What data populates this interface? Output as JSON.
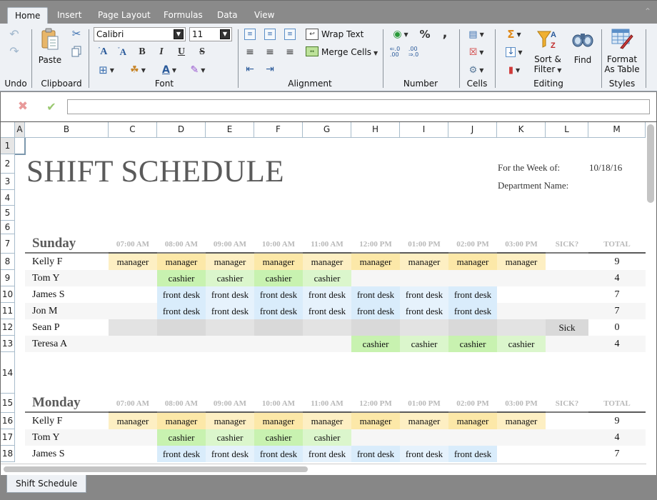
{
  "ribbon_tabs": [
    "Home",
    "Insert",
    "Page Layout",
    "Formulas",
    "Data",
    "View"
  ],
  "active_tab": "Home",
  "ribbon": {
    "groups": {
      "undo": "Undo",
      "clipboard": "Clipboard",
      "font": "Font",
      "alignment": "Alignment",
      "number": "Number",
      "cells": "Cells",
      "editing": "Editing",
      "styles": "Styles"
    },
    "paste_label": "Paste",
    "font_name": "Calibri",
    "font_size": "11",
    "wrap_text_label": "Wrap Text",
    "merge_cells_label": "Merge Cells",
    "sort_filter_line1": "Sort &",
    "sort_filter_line2": "Filter",
    "find_label": "Find",
    "format_table_line1": "Format",
    "format_table_line2": "As Table",
    "font_buttons": {
      "bold": "B",
      "italic": "I",
      "underline": "U",
      "strike": "S",
      "grow": "A",
      "shrink": "A"
    },
    "number_buttons": {
      "percent": "%",
      "comma": ","
    }
  },
  "formula_bar": {
    "value": ""
  },
  "columns": [
    "A",
    "B",
    "C",
    "D",
    "E",
    "F",
    "G",
    "H",
    "I",
    "J",
    "K",
    "L",
    "M"
  ],
  "rows": [
    "1",
    "2",
    "3",
    "4",
    "5",
    "6",
    "7",
    "8",
    "9",
    "10",
    "11",
    "12",
    "13",
    "14",
    "15",
    "16",
    "17",
    "18"
  ],
  "sheet": {
    "title": "SHIFT SCHEDULE",
    "week_label": "For the Week of:",
    "week_value": "10/18/16",
    "department_label": "Department Name:",
    "hours": [
      "07:00 AM",
      "08:00 AM",
      "09:00 AM",
      "10:00 AM",
      "11:00 AM",
      "12:00 PM",
      "01:00 PM",
      "02:00 PM",
      "03:00 PM"
    ],
    "sick_header": "SICK?",
    "total_header": "TOTAL",
    "days": [
      {
        "name": "Sunday",
        "employees": [
          {
            "name": "Kelly F",
            "shifts": [
              "manager",
              "manager",
              "manager",
              "manager",
              "manager",
              "manager",
              "manager",
              "manager",
              "manager"
            ],
            "sick": "",
            "total": "9"
          },
          {
            "name": "Tom Y",
            "shifts": [
              "",
              "cashier",
              "cashier",
              "cashier",
              "cashier",
              "",
              "",
              "",
              ""
            ],
            "sick": "",
            "total": "4"
          },
          {
            "name": "James S",
            "shifts": [
              "",
              "front desk",
              "front desk",
              "front desk",
              "front desk",
              "front desk",
              "front desk",
              "front desk",
              ""
            ],
            "sick": "",
            "total": "7"
          },
          {
            "name": "Jon M",
            "shifts": [
              "",
              "front desk",
              "front desk",
              "front desk",
              "front desk",
              "front desk",
              "front desk",
              "front desk",
              ""
            ],
            "sick": "",
            "total": "7"
          },
          {
            "name": "Sean P",
            "shifts": [
              "",
              "",
              "",
              "",
              "",
              "",
              "",
              "",
              ""
            ],
            "sick": "Sick",
            "total": "0"
          },
          {
            "name": "Teresa A",
            "shifts": [
              "",
              "",
              "",
              "",
              "",
              "cashier",
              "cashier",
              "cashier",
              "cashier"
            ],
            "sick": "",
            "total": "4"
          }
        ]
      },
      {
        "name": "Monday",
        "employees": [
          {
            "name": "Kelly F",
            "shifts": [
              "manager",
              "manager",
              "manager",
              "manager",
              "manager",
              "manager",
              "manager",
              "manager",
              "manager"
            ],
            "sick": "",
            "total": "9"
          },
          {
            "name": "Tom Y",
            "shifts": [
              "",
              "cashier",
              "cashier",
              "cashier",
              "cashier",
              "",
              "",
              "",
              ""
            ],
            "sick": "",
            "total": "4"
          },
          {
            "name": "James S",
            "shifts": [
              "",
              "front desk",
              "front desk",
              "front desk",
              "front desk",
              "front desk",
              "front desk",
              "front desk",
              ""
            ],
            "sick": "",
            "total": "7"
          }
        ]
      }
    ]
  },
  "colors": {
    "manager_a": "#fdefc3",
    "manager_b": "#fce8a8",
    "cashier_a": "#c8f2b0",
    "cashier_b": "#dbf6cc",
    "front_a": "#d9ecfb",
    "front_b": "#e6f2fc",
    "sick_a": "#e3e3e3",
    "sick_b": "#d9d9d9",
    "zebra": "#f6f6f6"
  },
  "sheet_tabs": [
    "Shift Schedule"
  ]
}
